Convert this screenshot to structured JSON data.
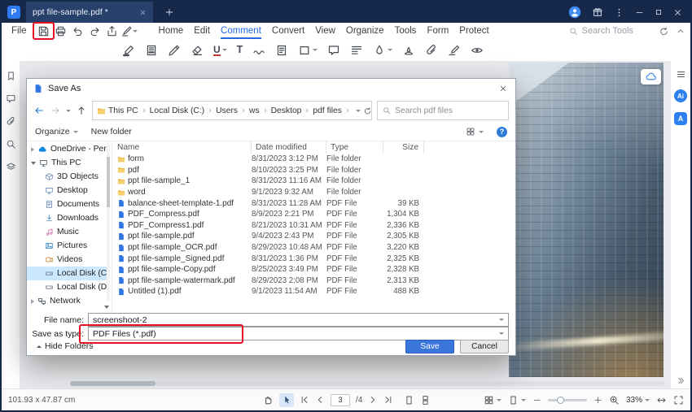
{
  "colors": {
    "titlebar": "#16294b",
    "accent": "#2667e4",
    "annotation": "#e81123",
    "save_button": "#3b76dd",
    "selection": "#cce8ff"
  },
  "titlebar": {
    "logo_glyph": "P",
    "tab_title": "ppt file-sample.pdf *"
  },
  "menubar": {
    "file_label": "File",
    "tabs": [
      "Home",
      "Edit",
      "Comment",
      "Convert",
      "View",
      "Organize",
      "Tools",
      "Form",
      "Protect"
    ],
    "active_tab": "Comment",
    "search_placeholder": "Search Tools"
  },
  "toolbar": {
    "underline_glyph": "U",
    "text_glyph": "T"
  },
  "rightbar": {
    "ai_badge": "Ai",
    "translate_badge": "A"
  },
  "dialog": {
    "title": "Save As",
    "path_segments": [
      "This PC",
      "Local Disk (C:)",
      "Users",
      "ws",
      "Desktop",
      "pdf files"
    ],
    "search_placeholder": "Search pdf files",
    "organize_label": "Organize",
    "new_folder_label": "New folder",
    "help_glyph": "?",
    "nav_items": [
      "OneDrive - Person...",
      "This PC",
      "3D Objects",
      "Desktop",
      "Documents",
      "Downloads",
      "Music",
      "Pictures",
      "Videos",
      "Local Disk (C:)",
      "Local Disk (D:)",
      "Network"
    ],
    "selected_nav": "Local Disk (C:)",
    "columns": [
      "Name",
      "Date modified",
      "Type",
      "Size"
    ],
    "files": [
      {
        "name": "form",
        "date": "8/31/2023 3:12 PM",
        "type": "File folder",
        "size": ""
      },
      {
        "name": "pdf",
        "date": "8/10/2023 3:25 PM",
        "type": "File folder",
        "size": ""
      },
      {
        "name": "ppt file-sample_1",
        "date": "8/31/2023 11:16 AM",
        "type": "File folder",
        "size": ""
      },
      {
        "name": "word",
        "date": "9/1/2023 9:32 AM",
        "type": "File folder",
        "size": ""
      },
      {
        "name": "balance-sheet-template-1.pdf",
        "date": "8/31/2023 11:28 AM",
        "type": "PDF File",
        "size": "39 KB"
      },
      {
        "name": "PDF_Compress.pdf",
        "date": "8/9/2023 2:21 PM",
        "type": "PDF File",
        "size": "1,304 KB"
      },
      {
        "name": "PDF_Compress1.pdf",
        "date": "8/21/2023 10:31 AM",
        "type": "PDF File",
        "size": "2,336 KB"
      },
      {
        "name": "ppt file-sample.pdf",
        "date": "9/4/2023 2:43 PM",
        "type": "PDF File",
        "size": "2,305 KB"
      },
      {
        "name": "ppt file-sample_OCR.pdf",
        "date": "8/29/2023 10:48 AM",
        "type": "PDF File",
        "size": "3,220 KB"
      },
      {
        "name": "ppt file-sample_Signed.pdf",
        "date": "8/31/2023 1:36 PM",
        "type": "PDF File",
        "size": "2,325 KB"
      },
      {
        "name": "ppt file-sample-Copy.pdf",
        "date": "8/25/2023 3:49 PM",
        "type": "PDF File",
        "size": "2,328 KB"
      },
      {
        "name": "ppt file-sample-watermark.pdf",
        "date": "8/29/2023 2:08 PM",
        "type": "PDF File",
        "size": "2,313 KB"
      },
      {
        "name": "Untitled (1).pdf",
        "date": "9/1/2023 11:54 AM",
        "type": "PDF File",
        "size": "488 KB"
      }
    ],
    "file_name_label": "File name:",
    "file_name_value": "screenshoot-2",
    "save_type_label": "Save as type:",
    "save_type_value": "PDF Files (*.pdf)",
    "hide_folders_label": "Hide Folders",
    "save_label": "Save",
    "cancel_label": "Cancel"
  },
  "statusbar": {
    "dimensions": "101.93 x 47.87 cm",
    "current_page": "3",
    "total_pages": "/4",
    "zoom": "33%"
  }
}
